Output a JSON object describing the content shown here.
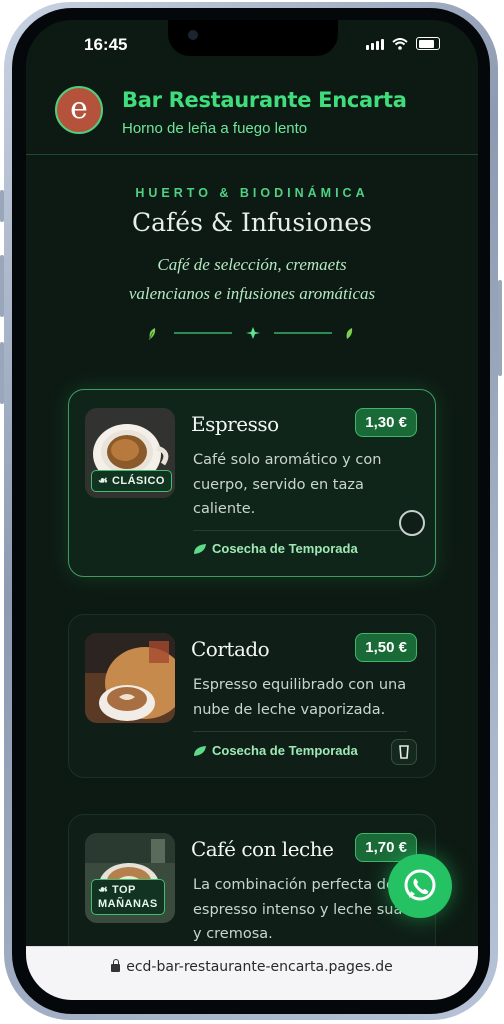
{
  "status": {
    "time": "16:45"
  },
  "header": {
    "logo_letter": "e",
    "brand": "Bar Restaurante Encarta",
    "tagline": "Horno de leña a fuego lento"
  },
  "section": {
    "eyebrow": "HUERTO & BIODINÁMICA",
    "title": "Cafés & Infusiones",
    "subtitle_line1": "Café de selección, cremaets",
    "subtitle_line2": "valencianos e infusiones aromáticas"
  },
  "items": [
    {
      "name": "Espresso",
      "price": "1,30 €",
      "badge": "CLÁSICO",
      "desc": "Café solo aromático y con cuerpo, servido en taza caliente.",
      "season": "Cosecha de Temporada"
    },
    {
      "name": "Cortado",
      "price": "1,50 €",
      "desc": "Espresso equilibrado con una nube de leche vaporizada.",
      "season": "Cosecha de Temporada"
    },
    {
      "name": "Café con leche",
      "price": "1,70 €",
      "badge_line1": "TOP",
      "badge_line2": "MAÑANAS",
      "desc": "La combinación perfecta de espresso intenso y leche suave y cremosa."
    }
  ],
  "browser": {
    "url": "ecd-bar-restaurante-encarta.pages.de"
  },
  "icons": [
    "leaf-icon",
    "sprout-icon",
    "whatsapp-icon",
    "lock-icon",
    "sparkle-icon"
  ],
  "colors": {
    "accent": "#3fdd7b",
    "background": "#0d1a13",
    "price_bg": "#1a6a38",
    "whatsapp": "#25c263"
  }
}
